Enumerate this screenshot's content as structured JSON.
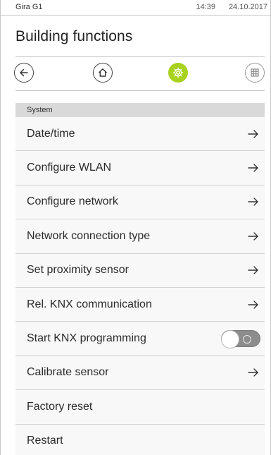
{
  "status_bar": {
    "device": "Gira G1",
    "time": "14:39",
    "date": "24.10.2017"
  },
  "page": {
    "title": "Building functions"
  },
  "toolbar": {
    "buttons": [
      {
        "name": "back-button",
        "icon": "arrow-left-icon"
      },
      {
        "name": "home-button",
        "icon": "house-icon"
      },
      {
        "name": "settings-button",
        "icon": "gear-icon",
        "active": true
      },
      {
        "name": "grid-button",
        "icon": "grid-icon"
      }
    ],
    "accent_color": "#a8d21c"
  },
  "section": {
    "header": "System"
  },
  "list": {
    "items": [
      {
        "label": "Date/time",
        "control": "arrow"
      },
      {
        "label": "Configure WLAN",
        "control": "arrow"
      },
      {
        "label": "Configure network",
        "control": "arrow"
      },
      {
        "label": "Network connection type",
        "control": "arrow"
      },
      {
        "label": "Set proximity sensor",
        "control": "arrow"
      },
      {
        "label": "Rel. KNX communication",
        "control": "arrow"
      },
      {
        "label": "Start KNX programming",
        "control": "toggle",
        "toggle_on": false
      },
      {
        "label": "Calibrate sensor",
        "control": "arrow"
      },
      {
        "label": "Factory reset",
        "control": "none"
      },
      {
        "label": "Restart",
        "control": "none"
      }
    ]
  }
}
